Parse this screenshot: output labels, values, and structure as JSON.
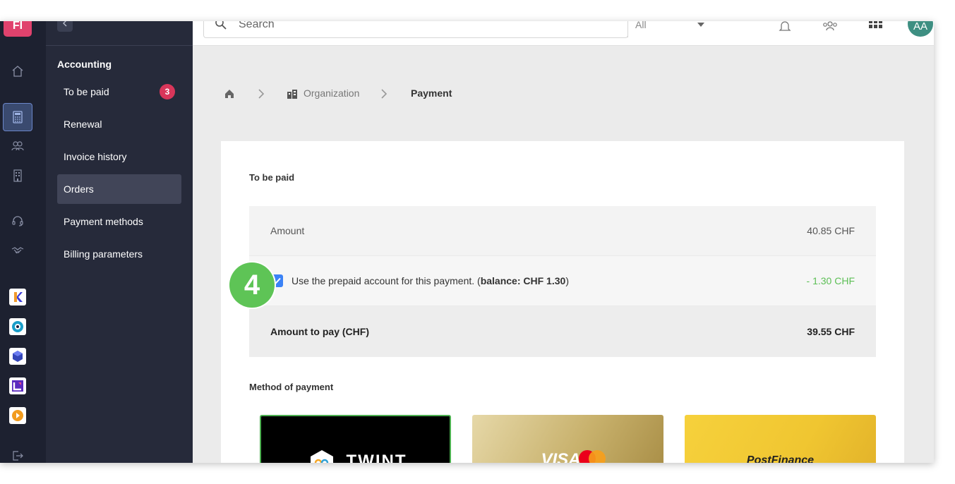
{
  "app": {
    "logo_text": "FI"
  },
  "topbar": {
    "search_placeholder": "Search",
    "search_filter": "All",
    "avatar_initials": "AA"
  },
  "sidebar": {
    "section_title": "Accounting",
    "items": [
      {
        "label": "To be paid",
        "badge": "3"
      },
      {
        "label": "Renewal"
      },
      {
        "label": "Invoice history"
      },
      {
        "label": "Orders",
        "active": true
      },
      {
        "label": "Payment methods"
      },
      {
        "label": "Billing parameters"
      }
    ]
  },
  "breadcrumb": {
    "items": [
      "Organization",
      "Payment"
    ]
  },
  "payment": {
    "section_title": "To be paid",
    "amount_label": "Amount",
    "amount_value": "40.85 CHF",
    "prepaid_text": "Use the prepaid account for this payment. (",
    "prepaid_balance": "balance: CHF 1.30",
    "prepaid_close": ")",
    "prepaid_checked": true,
    "prepaid_value": "- 1.30 CHF",
    "to_pay_label": "Amount to pay (CHF)",
    "to_pay_value": "39.55 CHF",
    "step_number": "4",
    "method_title": "Method of payment",
    "methods": [
      {
        "name": "TWINT",
        "selected": true
      },
      {
        "name": "VISA"
      },
      {
        "name": "PostFinance"
      }
    ]
  },
  "colors": {
    "accent": "#e0426d",
    "sidebar_bg": "#262a3a",
    "rail_bg": "#1d2130",
    "badge": "#d8365a",
    "success": "#5cbf55",
    "checkbox": "#3b82f6",
    "avatar": "#3e8f82"
  }
}
